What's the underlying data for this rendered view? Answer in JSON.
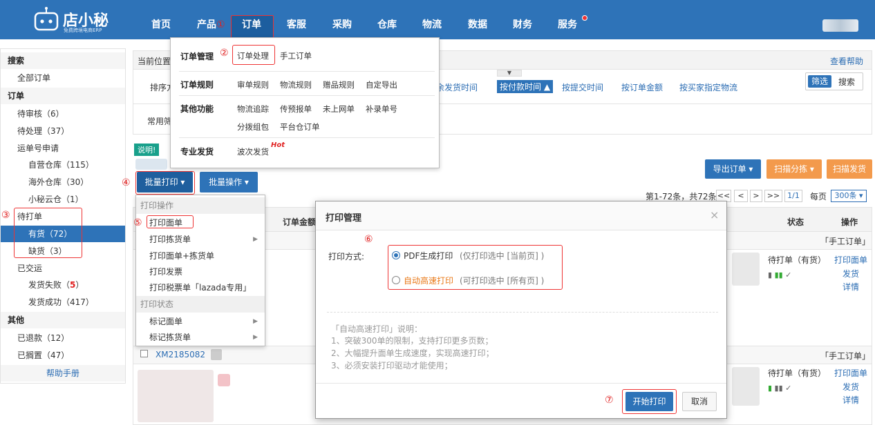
{
  "brand": {
    "name": "店小秘",
    "sub": "免费跨境电商ERP"
  },
  "nav": {
    "items": [
      "首页",
      "产品",
      "订单",
      "客服",
      "采购",
      "仓库",
      "物流",
      "数据",
      "财务",
      "服务"
    ]
  },
  "steps": [
    "①",
    "②",
    "③",
    "④",
    "⑤",
    "⑥",
    "⑦"
  ],
  "sidebar": {
    "search": "搜索",
    "all_orders": "全部订单",
    "order_header": "订单",
    "pending_review": "待审核（6）",
    "pending_process": "待处理（37）",
    "waybill_apply": "运单号申请",
    "own_wh": "自营仓库（115）",
    "overseas_wh": "海外仓库（30）",
    "cloud_wh": "小秘云仓（1）",
    "to_print": "待打单",
    "in_stock": "有货（72）",
    "out_stock": "缺货（3）",
    "shipped": "已交运",
    "ship_fail": "发货失败（",
    "ship_fail_count": "5",
    "ship_fail_close": "）",
    "ship_ok": "发货成功（417）",
    "other": "其他",
    "refunded": "已退款（12）",
    "shelved": "已搁置（47）",
    "help": "帮助手册"
  },
  "main": {
    "breadcrumb": "当前位置",
    "help_link": "查看帮助",
    "sort_label": "排序方",
    "sort_opts": [
      "余发货时间",
      "按付款时间 ▲",
      "按提交时间",
      "按订单金额",
      "按买家指定物流"
    ],
    "filter_btn": "筛选",
    "search_btn": "搜索",
    "common_filter": "常用筛",
    "notice_badge": "说明!",
    "export_btn": "导出订单 ▾",
    "scan_sort_btn": "扫描分拣 ▾",
    "scan_ship_btn": "扫描发货",
    "batch_print_btn": "批量打印 ▾",
    "batch_op_btn": "批量操作 ▾",
    "paging": "第1-72条，共72条",
    "page_first": "<<",
    "page_prev": "<",
    "page_next": ">",
    "page_last": ">>",
    "page_cur": "1/1",
    "per_page": "每页",
    "per_page_val": "300条 ▾",
    "col_amount": "订单金额",
    "col_status": "状态",
    "col_action": "操作",
    "manual_tag1": "「手工订单」",
    "manual_tag2": "「手工订单」",
    "row1_status": "待打单（有货）",
    "row2_status": "待打单（有货）",
    "action_print": "打印面单",
    "action_ship": "发货",
    "action_detail": "详情",
    "order_no": "XM2185082"
  },
  "megamenu": {
    "mgmt": "订单管理",
    "process": "订单处理",
    "manual": "手工订单",
    "rules": "订单规则",
    "rule_items": [
      "审单规则",
      "物流规则",
      "赠品规则",
      "自定导出"
    ],
    "other": "其他功能",
    "other_items": [
      "物流追踪",
      "传预报单",
      "未上网单",
      "补录单号"
    ],
    "other_items2": [
      "分拨组包",
      "平台仓订单"
    ],
    "pro": "专业发货",
    "wave": "波次发货",
    "hot": "Hot"
  },
  "printmenu": {
    "head1": "打印操作",
    "items": [
      "打印面单",
      "打印拣货单",
      "打印面单+拣货单",
      "打印发票",
      "打印税票单「lazada专用」"
    ],
    "head2": "打印状态",
    "items2": [
      "标记面单",
      "标记拣货单"
    ]
  },
  "modal": {
    "title": "打印管理",
    "close": "×",
    "method_label": "打印方式:",
    "opt1": "PDF生成打印",
    "opt1_note": "(仅打印选中 [当前页] )",
    "opt2": "自动高速打印",
    "opt2_note": "(可打印选中 [所有页] )",
    "explain_title": "「自动高速打印」说明：",
    "explain": [
      "1、突破300单的限制，支持打印更多页数；",
      "2、大幅提升面单生成速度，实现高速打印；",
      "3、必须安装打印驱动才能使用；"
    ],
    "start_btn": "开始打印",
    "cancel_btn": "取消"
  }
}
